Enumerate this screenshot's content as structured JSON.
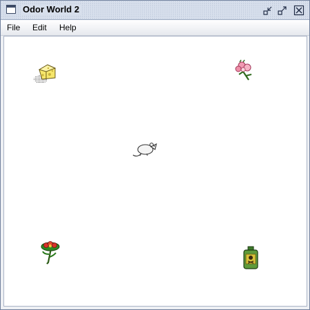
{
  "window": {
    "title": "Odor World 2",
    "controls": [
      "minimize-icon",
      "maximize-icon",
      "close-icon"
    ]
  },
  "menu": {
    "items": [
      {
        "label": "File"
      },
      {
        "label": "Edit"
      },
      {
        "label": "Help"
      }
    ]
  },
  "world": {
    "background": "#ffffff",
    "entities": [
      {
        "name": "cheese",
        "icon": "cheese-icon"
      },
      {
        "name": "pink-flower",
        "icon": "pink-flower-icon"
      },
      {
        "name": "mouse",
        "icon": "mouse-icon"
      },
      {
        "name": "red-flower",
        "icon": "red-flower-icon"
      },
      {
        "name": "poison-bottle",
        "icon": "poison-bottle-icon"
      }
    ]
  },
  "colors": {
    "titlebar": "#d7dfec",
    "window_border": "#6f7f9c",
    "canvas": "#ffffff"
  }
}
